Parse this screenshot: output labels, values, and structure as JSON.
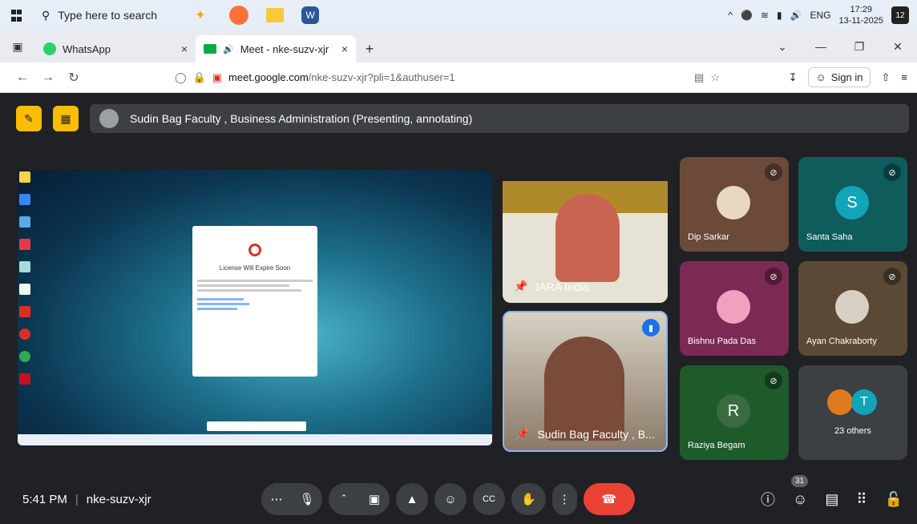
{
  "taskbar": {
    "search_placeholder": "Type here to search",
    "language": "ENG",
    "time": "17:29",
    "date": "13-11-2025",
    "notification_count": "12"
  },
  "browser": {
    "tabs": [
      {
        "title": "WhatsApp",
        "icon": "whatsapp-icon"
      },
      {
        "title": "Meet - nke-suzv-xjr",
        "icon": "meet-icon"
      }
    ],
    "url_host": "meet.google.com",
    "url_path": "/nke-suzv-xjr?pli=1&authuser=1",
    "sign_in": "Sign in"
  },
  "meet": {
    "presenter_text": "Sudin Bag Faculty , Business Administration (Presenting, annotating)",
    "meeting_time": "5:41 PM",
    "meeting_code": "nke-suzv-xjr",
    "participant_count": "31",
    "dialog_title": "License Will Expire Soon",
    "tiles": [
      {
        "name": "IARA India"
      },
      {
        "name": "Sudin Bag Faculty , B..."
      },
      {
        "name": "Dip Sarkar"
      },
      {
        "name": "Santa Saha",
        "initial": "S"
      },
      {
        "name": "Bishnu Pada Das"
      },
      {
        "name": "Ayan Chakraborty"
      },
      {
        "name": "Raziya Begam",
        "initial": "R"
      },
      {
        "name": "23 others",
        "initial": "T"
      }
    ]
  }
}
